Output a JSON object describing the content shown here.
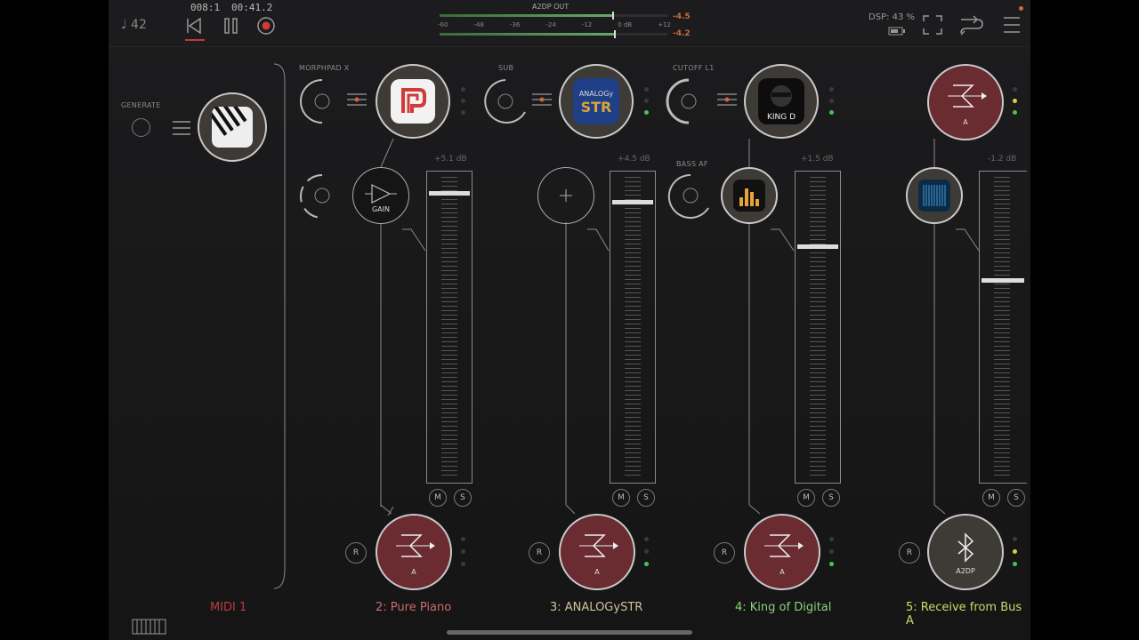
{
  "transport": {
    "tempo": "♩ 42",
    "position": "008:1",
    "time": "00:41.2"
  },
  "meter": {
    "title": "A2DP OUT",
    "ticks": [
      "-60",
      "-48",
      "-36",
      "-24",
      "-12",
      "0 dB",
      "+12"
    ],
    "peak_top": "-4.5",
    "peak_bottom": "-4.2"
  },
  "status": {
    "dsp": "DSP: 43 %"
  },
  "labels": {
    "generate": "GENERATE",
    "morphpad": "MORPHPAD X",
    "sub": "SUB",
    "cutoff": "CUTOFF L1",
    "bass_af": "BASS AF",
    "gain": "GAIN"
  },
  "channels": [
    {
      "name": "MIDI 1",
      "color": "#c0393f"
    },
    {
      "name": "2: Pure Piano",
      "color": "#d06a6a",
      "db": "+5.1 dB",
      "level": 0.92,
      "bus": "A",
      "plugin_icon": "pure-piano-icon"
    },
    {
      "name": "3: ANALOGySTR",
      "color": "#cfc39a",
      "db": "+4.5 dB",
      "level": 0.88,
      "bus": "A",
      "plugin_icon": "analogystr-icon",
      "plugin_text_1": "ANALOGy",
      "plugin_text_2": "STR"
    },
    {
      "name": "4: King of Digital",
      "color": "#8bd07a",
      "db": "+1.5 dB",
      "level": 0.75,
      "bus": "A",
      "plugin_icon": "king-of-digital-icon",
      "plugin_text": "KING D"
    },
    {
      "name": "5: Receive from Bus A",
      "color": "#cfd86a",
      "db": "-1.2 dB",
      "level": 0.62,
      "bus_in": "A",
      "output": "A2DP"
    }
  ],
  "buttons": {
    "mute": "M",
    "solo": "S",
    "record": "R"
  }
}
